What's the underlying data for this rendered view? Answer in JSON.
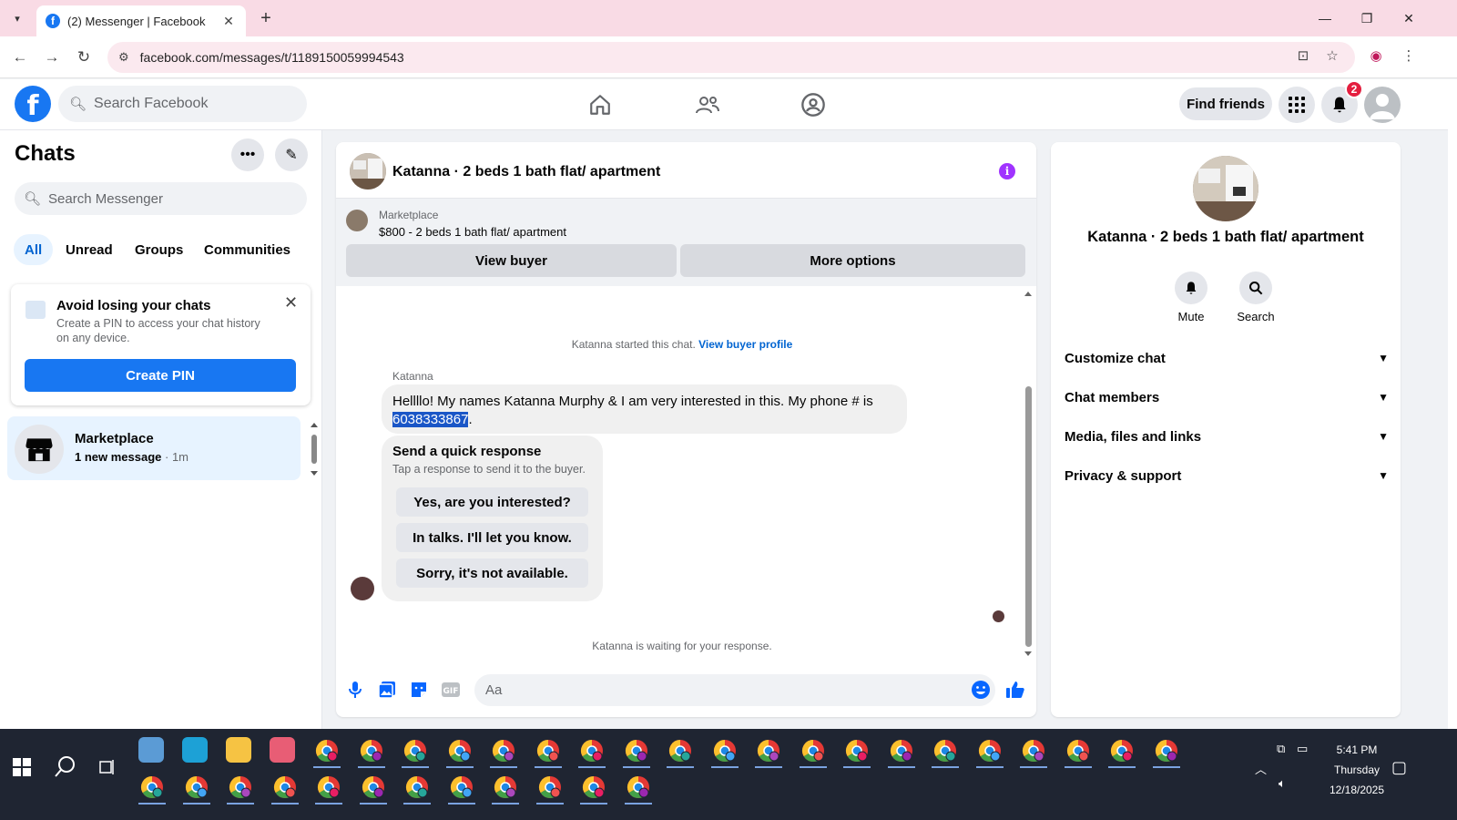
{
  "browser": {
    "tab_title": "(2) Messenger | Facebook",
    "url": "facebook.com/messages/t/1189150059994543"
  },
  "fb_header": {
    "search_placeholder": "Search Facebook",
    "find_friends": "Find friends",
    "notification_count": "2"
  },
  "chats_panel": {
    "title": "Chats",
    "search_placeholder": "Search Messenger",
    "filters": [
      "All",
      "Unread",
      "Groups",
      "Communities"
    ],
    "active_filter": "All",
    "pin_card": {
      "heading": "Avoid losing your chats",
      "body": "Create a PIN to access your chat history on any device.",
      "button": "Create PIN"
    },
    "chat_item": {
      "name": "Marketplace",
      "preview": "1 new message",
      "time": " · 1m"
    }
  },
  "conversation": {
    "title": "Katanna · 2 beds 1 bath flat/ apartment",
    "marketplace_label": "Marketplace",
    "listing": "$800 - 2 beds 1 bath flat/ apartment",
    "view_buyer": "View buyer",
    "more_options": "More options",
    "started_text": "Katanna started this chat.",
    "view_buyer_profile": "View buyer profile",
    "sender": "Katanna",
    "message_text": "Hellllo! My names Katanna Murphy & I am very interested in this. My phone # is",
    "message_phone": "6038333867",
    "message_end": ".",
    "quick_response_title": "Send a quick response",
    "quick_response_sub": "Tap a response to send it to the buyer.",
    "quick_responses": [
      "Yes, are you interested?",
      "In talks. I'll let you know.",
      "Sorry, it's not available."
    ],
    "waiting_text": "Katanna is waiting for your response.",
    "composer_placeholder": "Aa"
  },
  "info_panel": {
    "name": "Katanna · 2 beds 1 bath flat/ apartment",
    "actions": [
      "Mute",
      "Search"
    ],
    "sections": [
      "Customize chat",
      "Chat members",
      "Media, files and links",
      "Privacy & support"
    ]
  },
  "taskbar": {
    "time": "5:41 PM",
    "day": "Thursday",
    "date": "12/18/2025"
  },
  "colors": {
    "fb_blue": "#1877f2",
    "tab_bar": "#f9dbe5",
    "active_filter_bg": "#e7f3ff",
    "info_purple": "#a033ff",
    "badge_red": "#e41e3f"
  }
}
